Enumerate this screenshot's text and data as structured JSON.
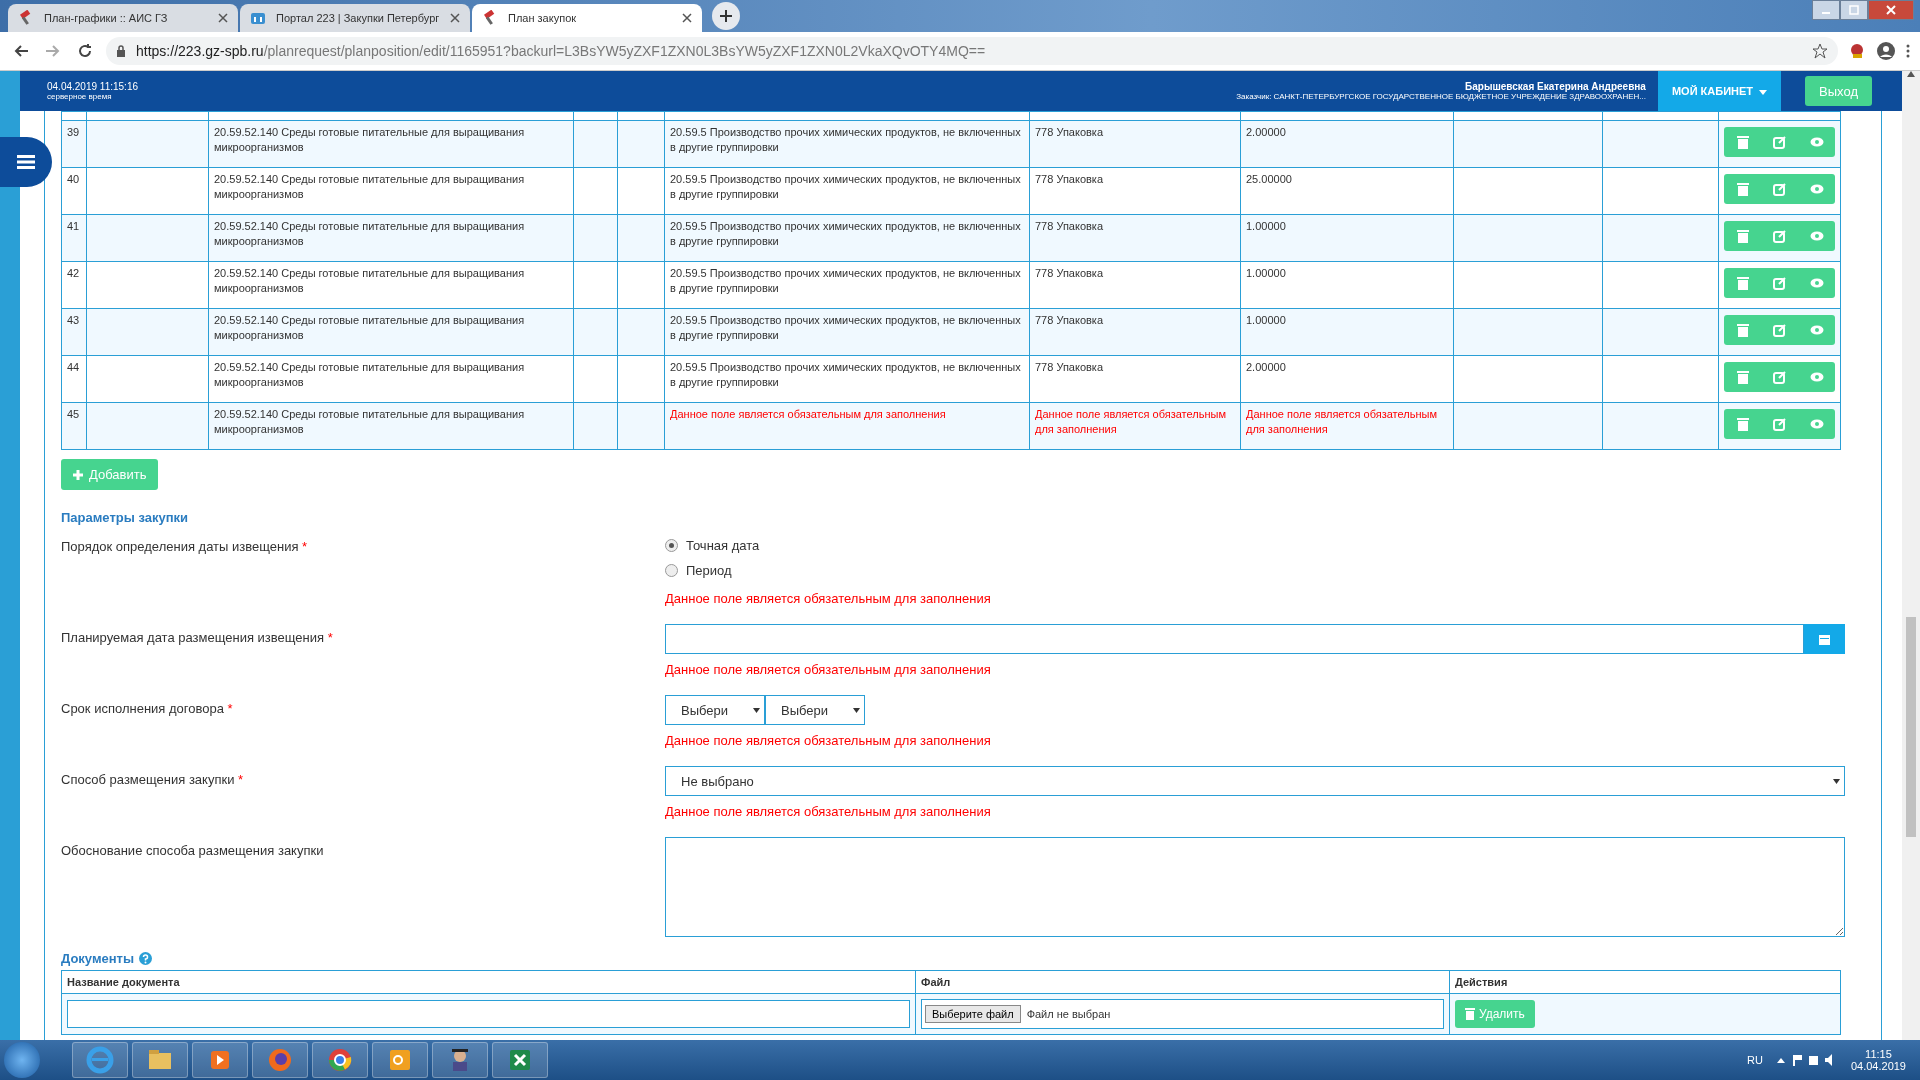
{
  "browser": {
    "tabs": [
      {
        "title": "План-графики :: АИС ГЗ",
        "selected": false
      },
      {
        "title": "Портал 223 | Закупки Петербург",
        "selected": false
      },
      {
        "title": "План закупок",
        "selected": true
      }
    ],
    "address": {
      "host": "https://223.gz-spb.ru",
      "path": "/planrequest/planposition/edit/1165951?backurl=L3BsYW5yZXF1ZXN0L3BsYW5yZXF1ZXN0L2VkaXQvOTY4MQ=="
    }
  },
  "header": {
    "datetime": "04.04.2019 11:15:16",
    "time_note": "серверное время",
    "user_name": "Барышевская Екатерина Андреевна",
    "customer": "Заказчик: САНКТ-ПЕТЕРБУРГСКОЕ ГОСУДАРСТВЕННОЕ БЮДЖЕТНОЕ УЧРЕЖДЕНИЕ ЗДРАВООХРАНЕН...",
    "cabinet_button": "МОЙ КАБИНЕТ",
    "logout_button": "Выход"
  },
  "table": {
    "rows": [
      {
        "number": "39",
        "okpd2": "20.59.52.140 Среды готовые питательные для выращивания микроорганизмов",
        "okved2": {
          "text": "20.59.5 Производство прочих химических продуктов, не включенных в другие группировки",
          "error": false
        },
        "unit": {
          "text": "778 Упаковка",
          "error": false
        },
        "quantity": {
          "text": "2.00000",
          "error": false
        }
      },
      {
        "number": "40",
        "okpd2": "20.59.52.140 Среды готовые питательные для выращивания микроорганизмов",
        "okved2": {
          "text": "20.59.5 Производство прочих химических продуктов, не включенных в другие группировки",
          "error": false
        },
        "unit": {
          "text": "778 Упаковка",
          "error": false
        },
        "quantity": {
          "text": "25.00000",
          "error": false
        }
      },
      {
        "number": "41",
        "okpd2": "20.59.52.140 Среды готовые питательные для выращивания микроорганизмов",
        "okved2": {
          "text": "20.59.5 Производство прочих химических продуктов, не включенных в другие группировки",
          "error": false
        },
        "unit": {
          "text": "778 Упаковка",
          "error": false
        },
        "quantity": {
          "text": "1.00000",
          "error": false
        }
      },
      {
        "number": "42",
        "okpd2": "20.59.52.140 Среды готовые питательные для выращивания микроорганизмов",
        "okved2": {
          "text": "20.59.5 Производство прочих химических продуктов, не включенных в другие группировки",
          "error": false
        },
        "unit": {
          "text": "778 Упаковка",
          "error": false
        },
        "quantity": {
          "text": "1.00000",
          "error": false
        }
      },
      {
        "number": "43",
        "okpd2": "20.59.52.140 Среды готовые питательные для выращивания микроорганизмов",
        "okved2": {
          "text": "20.59.5 Производство прочих химических продуктов, не включенных в другие группировки",
          "error": false
        },
        "unit": {
          "text": "778 Упаковка",
          "error": false
        },
        "quantity": {
          "text": "1.00000",
          "error": false
        }
      },
      {
        "number": "44",
        "okpd2": "20.59.52.140 Среды готовые питательные для выращивания микроорганизмов",
        "okved2": {
          "text": "20.59.5 Производство прочих химических продуктов, не включенных в другие группировки",
          "error": false
        },
        "unit": {
          "text": "778 Упаковка",
          "error": false
        },
        "quantity": {
          "text": "2.00000",
          "error": false
        }
      },
      {
        "number": "45",
        "okpd2": "20.59.52.140 Среды готовые питательные для выращивания микроорганизмов",
        "okved2": {
          "text": "Данное поле является обязательным для заполнения",
          "error": true
        },
        "unit": {
          "text": "Данное поле является обязательным для заполнения",
          "error": true
        },
        "quantity": {
          "text": "Данное поле является обязательным для заполнения",
          "error": true
        }
      }
    ]
  },
  "add_button": "Добавить",
  "section_title": "Параметры закупки",
  "fields": [
    {
      "kind": "radio",
      "label": "Порядок определения даты извещения",
      "required_mark": "*",
      "options": [
        {
          "label": "Точная дата",
          "selected": true
        },
        {
          "label": "Период",
          "selected": false
        }
      ],
      "error": "Данное поле является обязательным для заполнения"
    },
    {
      "kind": "date",
      "label": "Планируемая дата размещения извещения",
      "required_mark": "*",
      "error": "Данное поле является обязательным для заполнения"
    },
    {
      "kind": "selects",
      "label": "Срок исполнения договора",
      "required_mark": "*",
      "values": [
        "Выбери",
        "Выбери"
      ],
      "error": "Данное поле является обязательным для заполнения"
    },
    {
      "kind": "select",
      "label": "Способ размещения закупки",
      "required_mark": "*",
      "value": "Не выбрано",
      "error": "Данное поле является обязательным для заполнения"
    },
    {
      "kind": "textarea",
      "label": "Обоснование способа размещения закупки"
    }
  ],
  "documents": {
    "title": "Документы",
    "columns": [
      "Название документа",
      "Файл",
      "Действия"
    ],
    "rows": [
      {
        "file_button": "Выберите файл",
        "file_status": "Файл не выбран",
        "delete_button": "Удалить"
      }
    ]
  },
  "taskbar": {
    "language": "RU",
    "time": "11:15",
    "date": "04.04.2019"
  }
}
